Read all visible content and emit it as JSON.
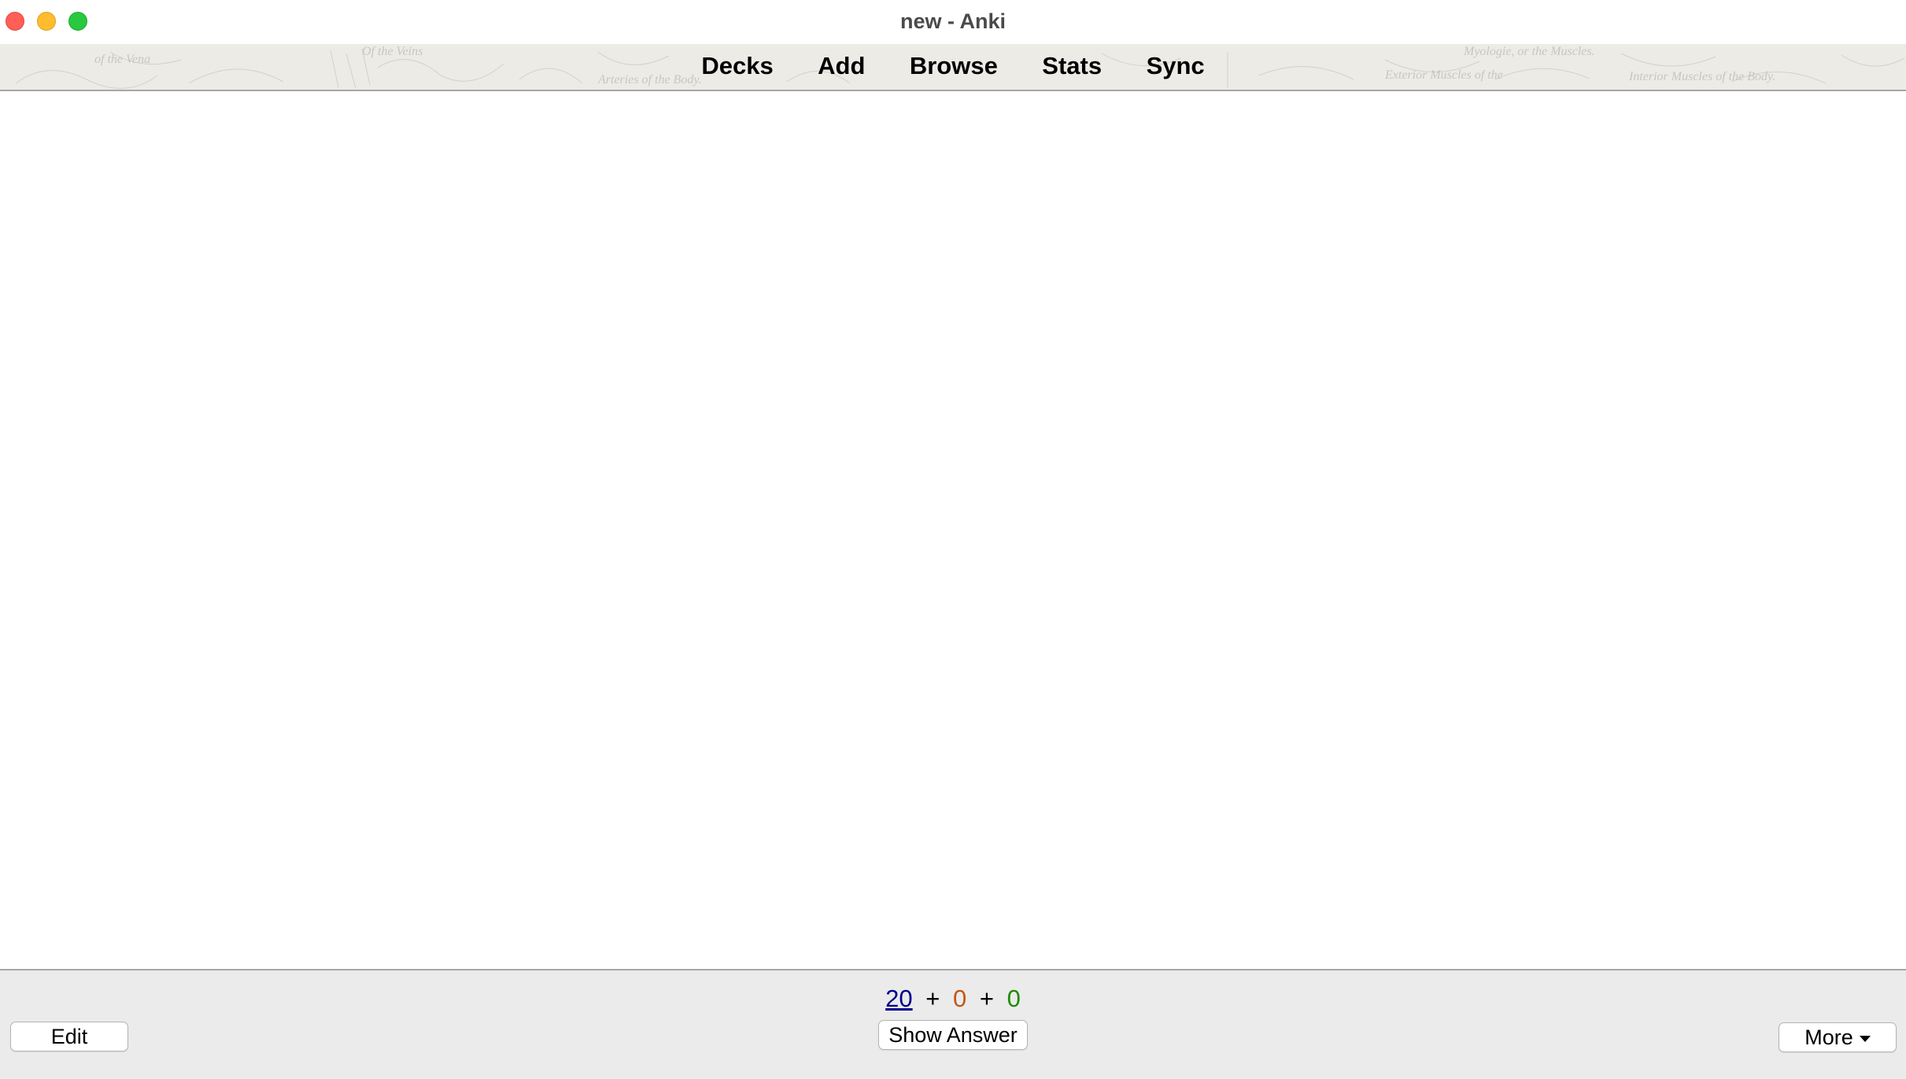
{
  "window": {
    "title": "new - Anki"
  },
  "toolbar": {
    "items": [
      {
        "label": "Decks"
      },
      {
        "label": "Add"
      },
      {
        "label": "Browse"
      },
      {
        "label": "Stats"
      },
      {
        "label": "Sync"
      }
    ]
  },
  "bottom": {
    "counts": {
      "new": "20",
      "learn": "0",
      "review": "0",
      "separator": "+"
    },
    "edit_label": "Edit",
    "show_answer_label": "Show Answer",
    "more_label": "More"
  },
  "colors": {
    "new_count": "#00008b",
    "learn_count": "#c35617",
    "review_count": "#1e8c00"
  },
  "icons": {
    "more_dropdown": "chevron-down-icon"
  }
}
